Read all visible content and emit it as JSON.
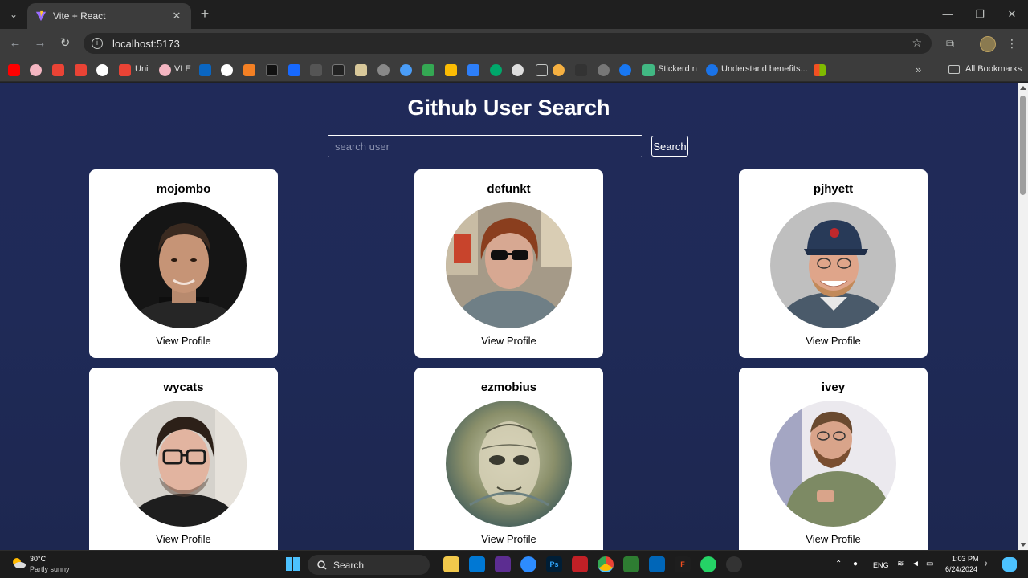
{
  "browser": {
    "tab_title": "Vite + React",
    "url": "localhost:5173",
    "bookmarks": {
      "uni_label": "Uni",
      "vle_label": "VLE",
      "stickerd_label": "Stickerd n",
      "understand_label": "Understand benefits...",
      "all_bookmarks_label": "All Bookmarks"
    }
  },
  "app": {
    "title": "Github User Search",
    "search_placeholder": "search user",
    "search_button": "Search",
    "view_profile_label": "View Profile",
    "users": [
      {
        "login": "mojombo"
      },
      {
        "login": "defunkt"
      },
      {
        "login": "pjhyett"
      },
      {
        "login": "wycats"
      },
      {
        "login": "ezmobius"
      },
      {
        "login": "ivey"
      }
    ]
  },
  "taskbar": {
    "weather_temp": "30°C",
    "weather_desc": "Partly sunny",
    "search_label": "Search",
    "language": "ENG",
    "time": "1:03 PM",
    "date": "6/24/2024"
  },
  "colors": {
    "page_bg": "#1f2a57",
    "card_bg": "#ffffff",
    "accent_windows": "#4cc2ff"
  }
}
